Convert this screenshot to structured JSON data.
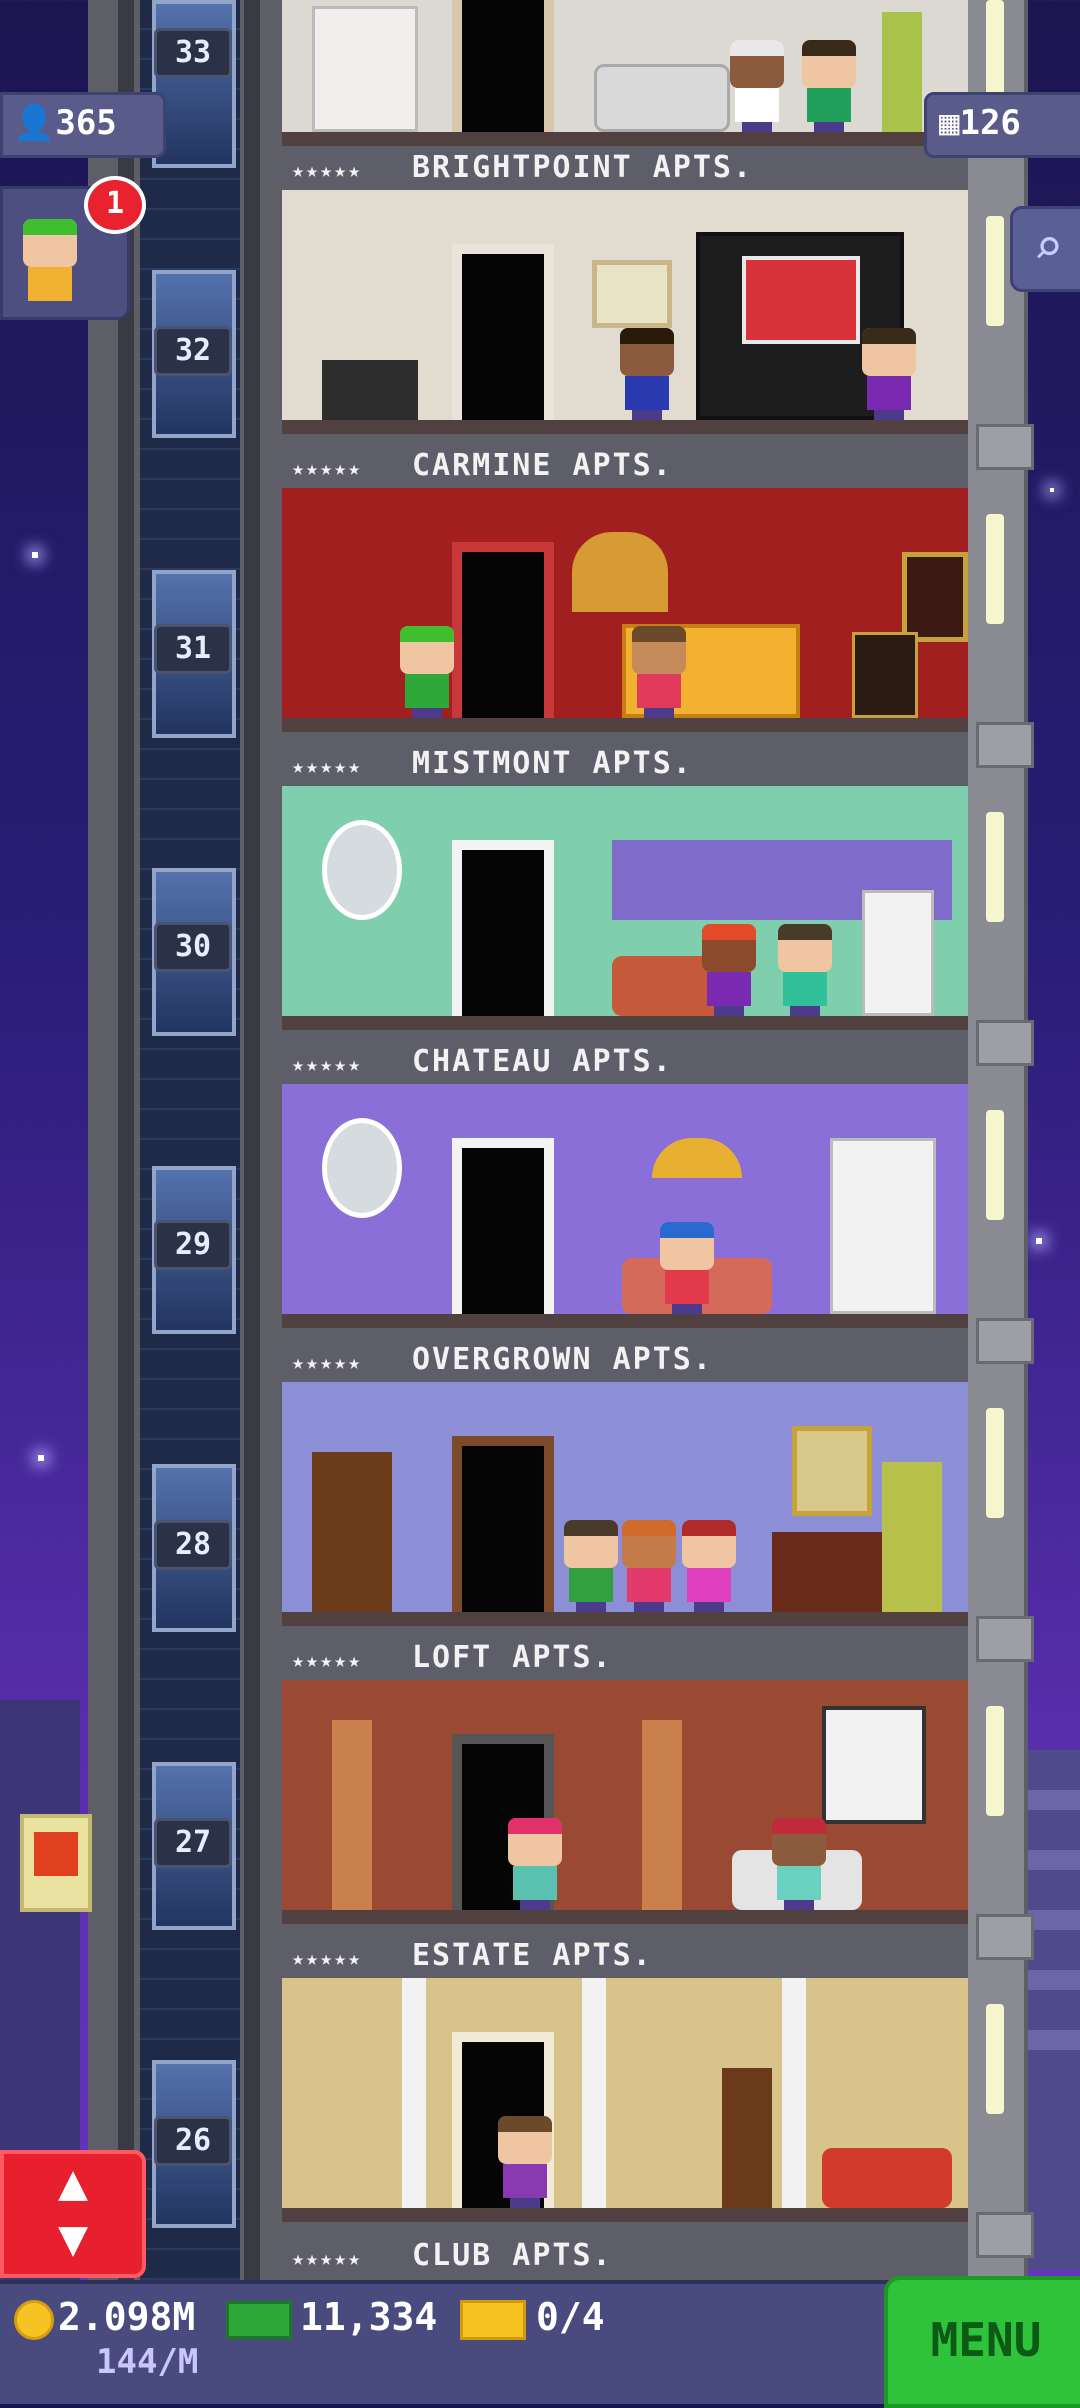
{
  "hud": {
    "population": "365",
    "floors_count": "126",
    "notification_count": "1"
  },
  "floor_numbers": [
    "33",
    "32",
    "31",
    "30",
    "29",
    "28",
    "27",
    "26"
  ],
  "floor_banners": [
    {
      "stars": "★★★★★",
      "name": "BRIGHTPOINT APTS."
    },
    {
      "stars": "★★★★★",
      "name": "CARMINE APTS."
    },
    {
      "stars": "★★★★★",
      "name": "MISTMONT APTS."
    },
    {
      "stars": "★★★★★",
      "name": "CHATEAU APTS."
    },
    {
      "stars": "★★★★★",
      "name": "OVERGROWN APTS."
    },
    {
      "stars": "★★★★★",
      "name": "LOFT APTS."
    },
    {
      "stars": "★★★★★",
      "name": "ESTATE APTS."
    },
    {
      "stars": "★★★★★",
      "name": "CLUB APTS."
    }
  ],
  "bottom_bar": {
    "coins": "2.098M",
    "coins_rate": "144/M",
    "bux": "11,334",
    "tickets": "0/4",
    "menu_label": "MENU"
  },
  "icons": {
    "population": "person-icon",
    "floors": "building-icon",
    "search": "magnifier-icon",
    "elevator_toggle": "up-down-arrows-icon",
    "coin": "coin-icon",
    "bux": "cash-icon",
    "tickets": "ticket-icon"
  },
  "colors": {
    "menu_button": "#2fc23b",
    "elevator_button": "#e8202e",
    "notification": "#e8222f",
    "coin": "#f5c322",
    "bux": "#2fa83a"
  }
}
